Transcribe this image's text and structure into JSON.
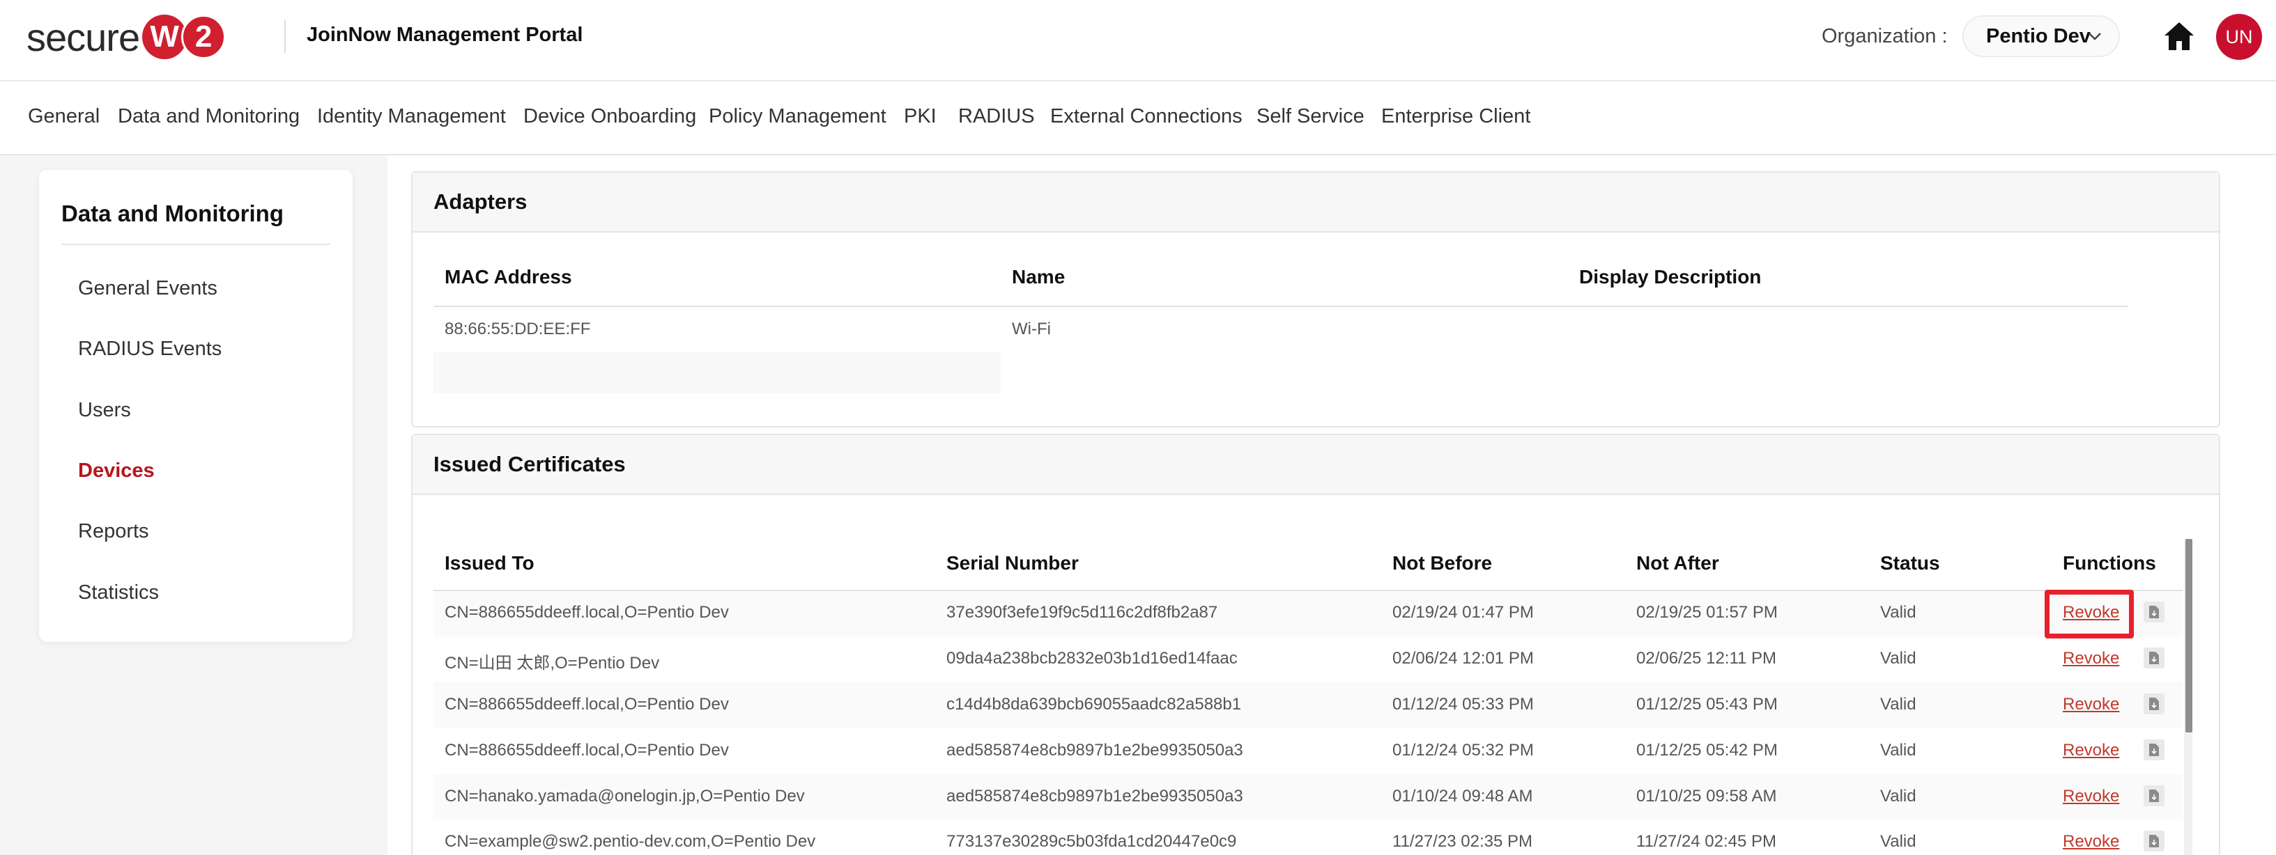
{
  "header": {
    "logo_text": "secure",
    "logo_w": "W",
    "logo_2": "2",
    "portal_title": "JoinNow Management Portal",
    "org_label": "Organization :",
    "org_value": "Pentio Dev",
    "avatar_initials": "UN"
  },
  "nav": {
    "items": [
      "General",
      "Data and Monitoring",
      "Identity Management",
      "Device Onboarding",
      "Policy Management",
      "PKI",
      "RADIUS",
      "External Connections",
      "Self Service",
      "Enterprise Client"
    ]
  },
  "sidebar": {
    "title": "Data and Monitoring",
    "items": [
      "General Events",
      "RADIUS Events",
      "Users",
      "Devices",
      "Reports",
      "Statistics"
    ],
    "active": "Devices"
  },
  "adapters": {
    "title": "Adapters",
    "columns": [
      "MAC Address",
      "Name",
      "Display Description"
    ],
    "rows": [
      {
        "mac": "88:66:55:DD:EE:FF",
        "name": "Wi-Fi",
        "description": ""
      }
    ]
  },
  "certificates": {
    "title": "Issued Certificates",
    "columns": [
      "Issued To",
      "Serial Number",
      "Not Before",
      "Not After",
      "Status",
      "Functions"
    ],
    "revoke_label": "Revoke",
    "rows": [
      {
        "issued_to": "CN=886655ddeeff.local,O=Pentio Dev",
        "serial": "37e390f3efe19f9c5d116c2df8fb2a87",
        "not_before": "02/19/24 01:47 PM",
        "not_after": "02/19/25 01:57 PM",
        "status": "Valid"
      },
      {
        "issued_to": "CN=山田 太郎,O=Pentio Dev",
        "serial": "09da4a238bcb2832e03b1d16ed14faac",
        "not_before": "02/06/24 12:01 PM",
        "not_after": "02/06/25 12:11 PM",
        "status": "Valid"
      },
      {
        "issued_to": "CN=886655ddeeff.local,O=Pentio Dev",
        "serial": "c14d4b8da639bcb69055aadc82a588b1",
        "not_before": "01/12/24 05:33 PM",
        "not_after": "01/12/25 05:43 PM",
        "status": "Valid"
      },
      {
        "issued_to": "CN=886655ddeeff.local,O=Pentio Dev",
        "serial": "aed585874e8cb9897b1e2be9935050a3",
        "not_before": "01/12/24 05:32 PM",
        "not_after": "01/12/25 05:42 PM",
        "status": "Valid"
      },
      {
        "issued_to": "CN=hanako.yamada@onelogin.jp,O=Pentio Dev",
        "serial": "aed585874e8cb9897b1e2be9935050a3",
        "not_before": "01/10/24 09:48 AM",
        "not_after": "01/10/25 09:58 AM",
        "status": "Valid"
      },
      {
        "issued_to": "CN=example@sw2.pentio-dev.com,O=Pentio Dev",
        "serial": "773137e30289c5b03fda1cd20447e0c9",
        "not_before": "11/27/23 02:35 PM",
        "not_after": "11/27/24 02:45 PM",
        "status": "Valid"
      }
    ]
  },
  "colors": {
    "brand_red": "#d01f2f",
    "active_red": "#b8141e",
    "highlight_red": "#e8212e",
    "revoke_link": "#c0392b"
  },
  "icons": {
    "home": "home-icon",
    "chevron": "chevron-down-icon",
    "download": "download-file-icon"
  }
}
